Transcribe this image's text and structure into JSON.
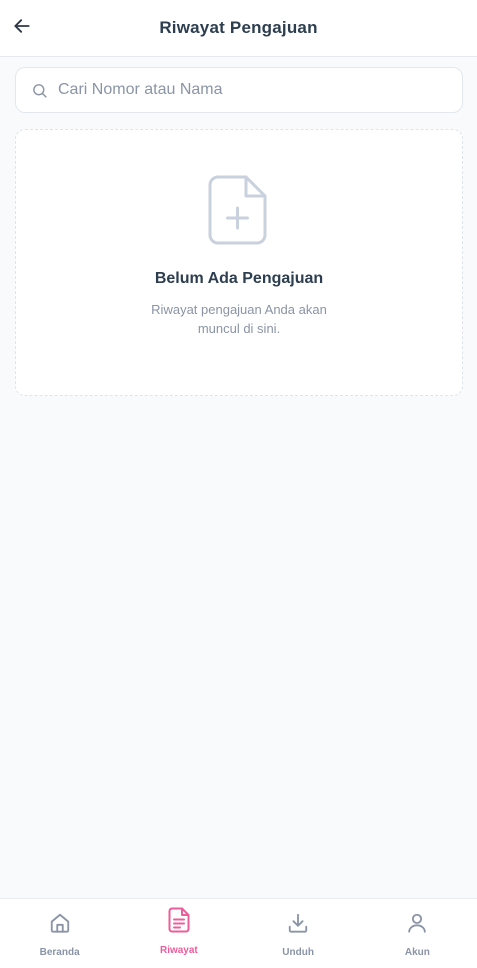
{
  "header": {
    "title": "Riwayat Pengajuan",
    "back_icon": "arrow-left-icon"
  },
  "search": {
    "placeholder": "Cari Nomor atau Nama",
    "value": "",
    "icon": "search-icon"
  },
  "empty_state": {
    "icon": "file-plus-icon",
    "title": "Belum Ada Pengajuan",
    "subtitle": "Riwayat pengajuan Anda akan muncul di sini."
  },
  "bottom_nav": {
    "items": [
      {
        "label": "Beranda",
        "icon": "home-icon",
        "active": false
      },
      {
        "label": "Riwayat",
        "icon": "document-icon",
        "active": true
      },
      {
        "label": "Unduh",
        "icon": "download-icon",
        "active": false
      },
      {
        "label": "Akun",
        "icon": "user-icon",
        "active": false
      }
    ]
  },
  "colors": {
    "accent": "#ec5d9a",
    "text_dark": "#2d3e50",
    "text_muted": "#8a94a6",
    "background": "#f8fafc"
  }
}
